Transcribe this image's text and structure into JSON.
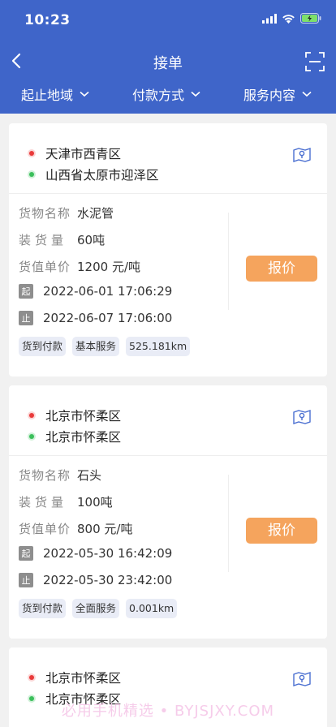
{
  "status": {
    "time": "10:23"
  },
  "nav": {
    "title": "接单"
  },
  "filters": [
    {
      "label": "起止地域"
    },
    {
      "label": "付款方式"
    },
    {
      "label": "服务内容"
    }
  ],
  "labels": {
    "cargo_name": "货物名称",
    "load_amount": "装货量",
    "unit_price": "货值单价",
    "start_mark": "起",
    "end_mark": "止",
    "quote_button": "报价"
  },
  "orders": [
    {
      "from": "天津市西青区",
      "to": "山西省太原市迎泽区",
      "cargo": "水泥管",
      "amount": "60吨",
      "price": "1200 元/吨",
      "start_time": "2022-06-01 17:06:29",
      "end_time": "2022-06-07 17:06:00",
      "tags": [
        "货到付款",
        "基本服务",
        "525.181km"
      ]
    },
    {
      "from": "北京市怀柔区",
      "to": "北京市怀柔区",
      "cargo": "石头",
      "amount": "100吨",
      "price": "800 元/吨",
      "start_time": "2022-05-30 16:42:09",
      "end_time": "2022-05-30 23:42:00",
      "tags": [
        "货到付款",
        "全面服务",
        "0.001km"
      ]
    },
    {
      "from": "北京市怀柔区",
      "to": "北京市怀柔区"
    }
  ],
  "watermark": "必用手机精选 • BYJSJXY.COM",
  "colors": {
    "header": "#3f65c9",
    "quote": "#f5a45d",
    "tag_bg": "#e9ecf6"
  }
}
